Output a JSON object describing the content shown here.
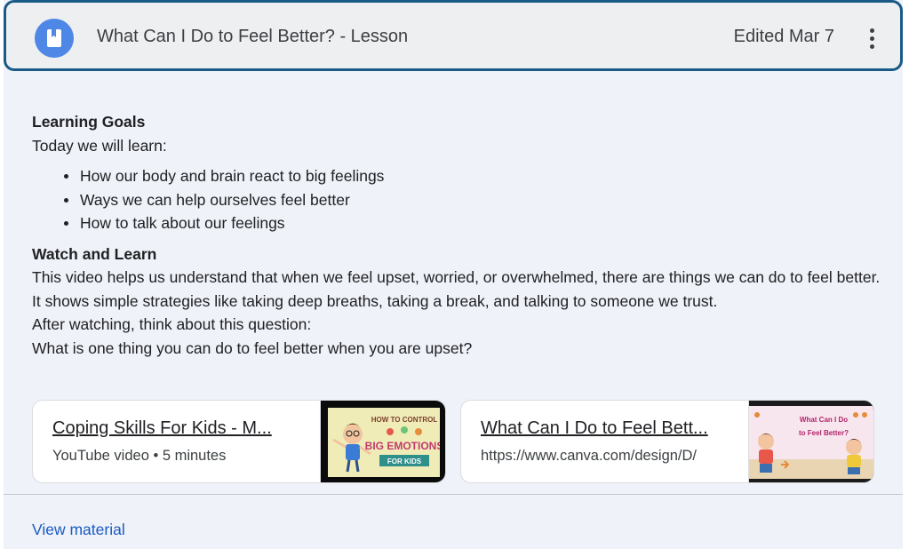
{
  "header": {
    "icon": "book-bookmark-icon",
    "title": "What Can I Do to Feel Better? - Lesson",
    "edited": "Edited Mar 7",
    "more_icon": "more-vertical-icon"
  },
  "body": {
    "goals_heading": "Learning Goals",
    "goals_intro": "Today we will learn:",
    "goals": [
      "How our body and brain react to big feelings",
      " Ways we can help ourselves feel better",
      " How to talk about our feelings"
    ],
    "watch_heading": "Watch and Learn",
    "watch_text": "This video helps us understand that when we feel upset, worried, or overwhelmed, there are things we can do to feel better. It shows simple strategies like taking deep breaths, taking a break, and talking to someone we trust.",
    "after_text": "After watching, think about this question:",
    "question": "What is one thing you can do to feel better when you are upset?"
  },
  "attachments": [
    {
      "title": "Coping Skills For Kids - M...",
      "subtitle": "YouTube video • 5 minutes",
      "thumb_text_1": "HOW TO CONTROL",
      "thumb_text_2": "BIG EMOTIONS",
      "thumb_text_3": "FOR KIDS"
    },
    {
      "title": "What Can I Do to Feel Bett...",
      "subtitle": "https://www.canva.com/design/D/",
      "thumb_text_1": "What Can I Do",
      "thumb_text_2": "to Feel Better?"
    }
  ],
  "footer": {
    "view_label": "View material"
  },
  "colors": {
    "accent": "#1a5a86",
    "avatar": "#4e87e6",
    "link": "#1a5bc4"
  }
}
